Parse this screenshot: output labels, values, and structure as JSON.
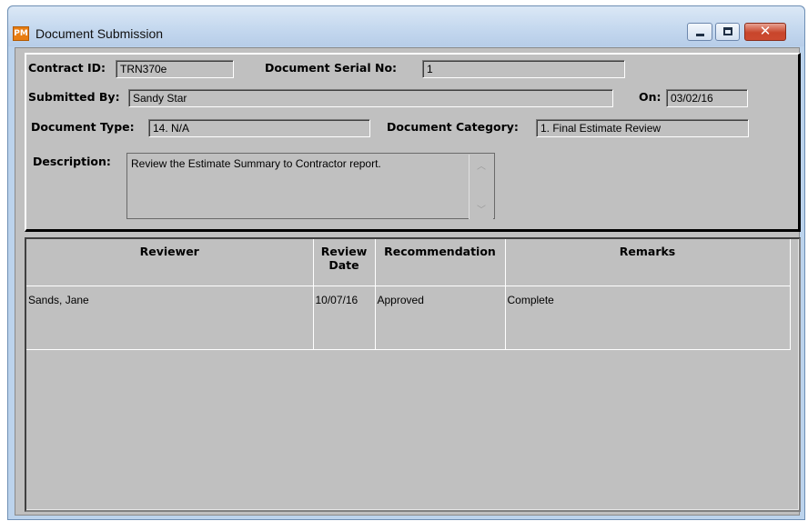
{
  "window": {
    "title": "Document Submission",
    "icon_text": "PM",
    "controls": {
      "minimize": "minimize",
      "maximize": "maximize",
      "close": "✕"
    }
  },
  "form": {
    "contract_id_label": "Contract ID:",
    "contract_id_value": "TRN370e",
    "serial_label": "Document Serial No:",
    "serial_value": "1",
    "submitted_by_label": "Submitted By:",
    "submitted_by_value": "Sandy Star",
    "on_label": "On:",
    "on_value": "03/02/16",
    "doc_type_label": "Document Type:",
    "doc_type_value": "14. N/A",
    "doc_category_label": "Document Category:",
    "doc_category_value": "1. Final Estimate Review",
    "description_label": "Description:",
    "description_value": "Review the Estimate Summary to Contractor report."
  },
  "table": {
    "headers": [
      "Reviewer",
      "Review Date",
      "Recommendation",
      "Remarks"
    ],
    "rows": [
      {
        "reviewer": "Sands, Jane",
        "date": "10/07/16",
        "recommendation": "Approved",
        "remarks": "Complete"
      }
    ]
  },
  "colors": {
    "accent": "#e87d12",
    "panel": "#c0c0c0",
    "titlebar": "#c3d7ee"
  }
}
